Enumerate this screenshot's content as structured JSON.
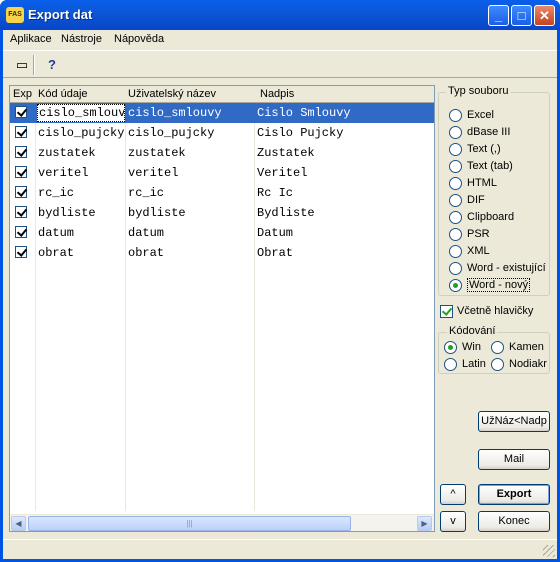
{
  "window": {
    "title": "Export dat",
    "app_icon": "FAS"
  },
  "menu": [
    "Aplikace",
    "Nástroje",
    "Nápověda"
  ],
  "toolbar": {
    "tool1": "▭",
    "tool2": "?"
  },
  "grid": {
    "columns": [
      "Exp",
      "Kód údaje",
      "Uživatelský název",
      "Nadpis"
    ],
    "rows": [
      {
        "code": "cislo_smlouvy",
        "name": "cislo_smlouvy",
        "title": "Cislo Smlouvy"
      },
      {
        "code": "cislo_pujcky",
        "name": "cislo_pujcky",
        "title": "Cislo Pujcky"
      },
      {
        "code": "zustatek",
        "name": "zustatek",
        "title": "Zustatek"
      },
      {
        "code": "veritel",
        "name": "veritel",
        "title": "Veritel"
      },
      {
        "code": "rc_ic",
        "name": "rc_ic",
        "title": "Rc Ic"
      },
      {
        "code": "bydliste",
        "name": "bydliste",
        "title": "Bydliste"
      },
      {
        "code": "datum",
        "name": "datum",
        "title": "Datum"
      },
      {
        "code": "obrat",
        "name": "obrat",
        "title": "Obrat"
      }
    ]
  },
  "file_type": {
    "title": "Typ souboru",
    "options": [
      "Excel",
      "dBase III",
      "Text (,)",
      "Text (tab)",
      "HTML",
      "DIF",
      "Clipboard",
      "PSR",
      "XML",
      "Word - existující",
      "Word - nový"
    ],
    "selected": "Word - nový"
  },
  "header_checkbox": {
    "label": "Včetně hlavičky",
    "checked": true
  },
  "encoding": {
    "title": "Kódování",
    "options": [
      "Win",
      "Kamen",
      "Latin",
      "Nodiakr"
    ],
    "selected": "Win"
  },
  "buttons": {
    "user_title": "UžNáz<Nadp",
    "mail": "Mail",
    "up": "^",
    "down": "v",
    "export": "Export",
    "close": "Konec"
  }
}
